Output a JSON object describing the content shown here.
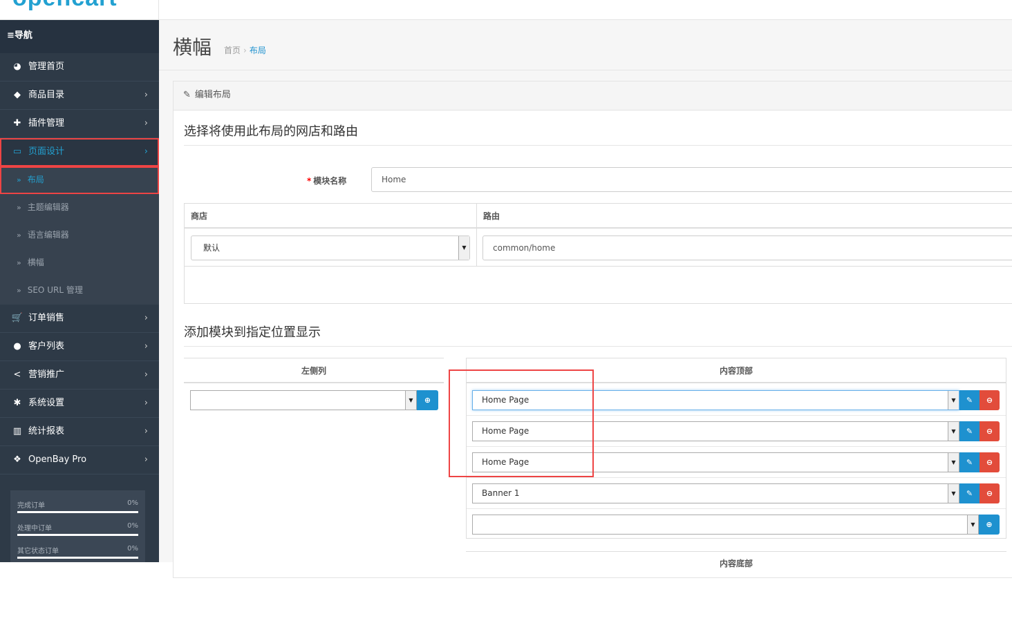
{
  "header": {
    "logo_text": "opencart"
  },
  "sidebar": {
    "title": "≡导航",
    "items": [
      {
        "label": "管理首页",
        "icon": "dashboard-icon",
        "glyph": "◕"
      },
      {
        "label": "商品目录",
        "icon": "tags-icon",
        "glyph": "◆"
      },
      {
        "label": "插件管理",
        "icon": "puzzle-icon",
        "glyph": "✚"
      },
      {
        "label": "页面设计",
        "icon": "desktop-icon",
        "glyph": "▭"
      }
    ],
    "sub_items": [
      {
        "label": "布局"
      },
      {
        "label": "主题编辑器"
      },
      {
        "label": "语言编辑器"
      },
      {
        "label": "横幅"
      },
      {
        "label": "SEO URL 管理"
      }
    ],
    "items2": [
      {
        "label": "订单销售",
        "icon": "cart-icon",
        "glyph": "🛒"
      },
      {
        "label": "客户列表",
        "icon": "user-icon",
        "glyph": "●"
      },
      {
        "label": "营销推广",
        "icon": "share-icon",
        "glyph": "<"
      },
      {
        "label": "系统设置",
        "icon": "cog-icon",
        "glyph": "✱"
      },
      {
        "label": "统计报表",
        "icon": "bar-chart-icon",
        "glyph": "▥"
      },
      {
        "label": "OpenBay Pro",
        "icon": "cubes-icon",
        "glyph": "❖"
      }
    ],
    "stats": [
      {
        "label": "完成订单",
        "value": "0%"
      },
      {
        "label": "处理中订单",
        "value": "0%"
      },
      {
        "label": "其它状态订单",
        "value": "0%"
      }
    ]
  },
  "page": {
    "title": "横幅",
    "breadcrumb": [
      "首页",
      "布局"
    ]
  },
  "panel": {
    "heading": "编辑布局",
    "section1_legend": "选择将使用此布局的网店和路由",
    "name_label": "模块名称",
    "name_value": "Home",
    "table_headers": [
      "商店",
      "路由"
    ],
    "store_value": "默认",
    "route_value": "common/home",
    "section2_legend": "添加模块到指定位置显示",
    "left_column_title": "左侧列",
    "content_top_title": "内容顶部",
    "content_top_modules": [
      "Home Page",
      "Home Page",
      "Home Page",
      "Banner 1"
    ],
    "next_column_title": "内容底部"
  }
}
